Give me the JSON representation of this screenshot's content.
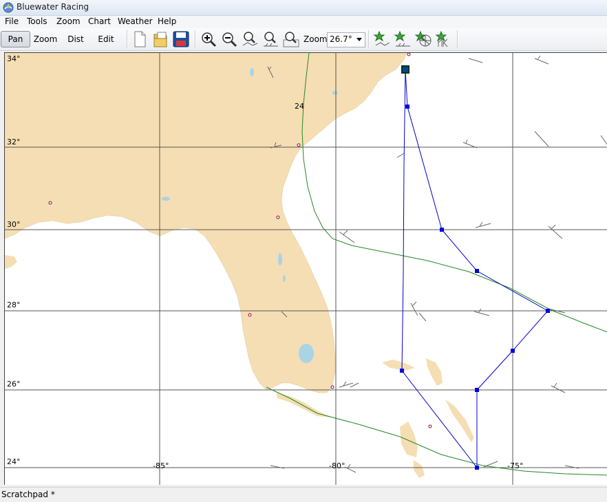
{
  "window": {
    "title": "Bluewater Racing"
  },
  "menu": [
    "File",
    "Tools",
    "Zoom",
    "Chart",
    "Weather",
    "Help"
  ],
  "toolbar": {
    "pan": "Pan",
    "zoom": "Zoom",
    "dist": "Dist",
    "edit": "Edit",
    "zoom_label": "Zoom",
    "zoom_value": "26.7°",
    "icons": [
      "new-file-icon",
      "open-file-icon",
      "save-icon",
      "zoom-in-icon",
      "zoom-out-icon",
      "zoom-route-icon",
      "zoom-wind-icon",
      "zoom-fit-icon",
      "star-route-icon",
      "star-wind-icon",
      "star-polar-icon",
      "star-k-icon"
    ]
  },
  "map": {
    "lat_labels": [
      "34°",
      "32°",
      "30°",
      "28°",
      "26°",
      "24°"
    ],
    "lon_labels": [
      "-85°",
      "-80°",
      "-75°"
    ],
    "isochrone_label": "24",
    "colors": {
      "land": "#f5deb3",
      "water": "#ffffff",
      "grid": "#555555",
      "route": "#0000cc",
      "isochrone": "#228822",
      "label_red": "#cc0000",
      "lake": "#a8d4e6"
    }
  },
  "status": {
    "text": "Scratchpad *"
  }
}
